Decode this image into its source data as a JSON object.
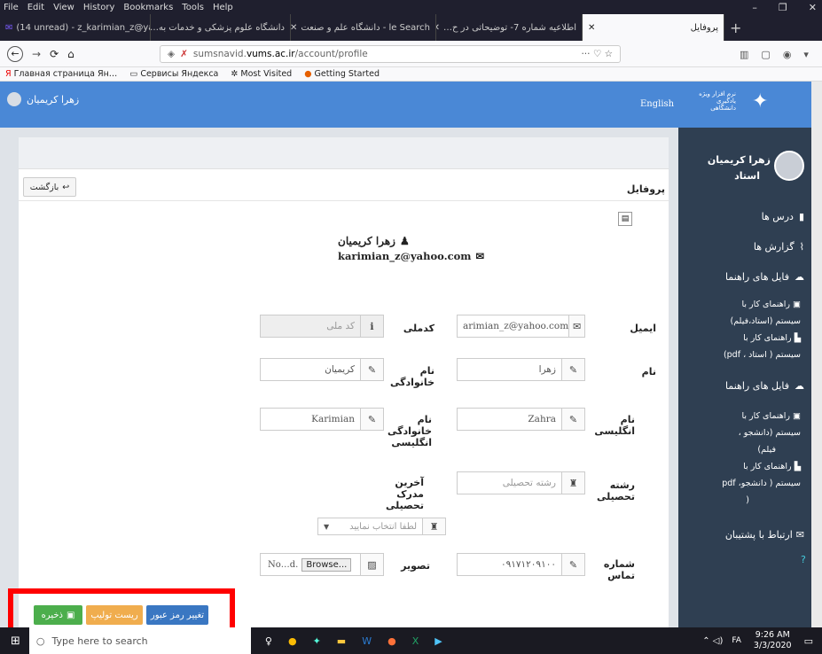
{
  "menu": [
    "File",
    "Edit",
    "View",
    "History",
    "Bookmarks",
    "Tools",
    "Help"
  ],
  "tabs": [
    {
      "label": "(14 unread) - z_karimian_z@ya…"
    },
    {
      "label": "دانشگاه علوم پزشکی و خدمات به…"
    },
    {
      "label": "le Search - دانشگاه علم و صنعت"
    },
    {
      "label": "اطلاعیه شماره 7- توضیحاتی در ح…"
    },
    {
      "label": "پروفایل"
    }
  ],
  "new_tab": "+",
  "url": {
    "prefix": "sumsnavid.",
    "domain": "vums.ac.ir",
    "path": "/account/profile"
  },
  "nav": {
    "more": "···"
  },
  "bookmarks": [
    "Главная страница Ян…",
    "Сервисы Яндекса",
    "Most Visited",
    "Getting Started"
  ],
  "header": {
    "user_name": "زهرا کریمیان",
    "lang": "English",
    "logo_line1": "نرم افزار ویژه",
    "logo_line2": "یادگیری دانشگاهی"
  },
  "sidebar": {
    "user_name": "زهرا کریمیان",
    "role": "استاد",
    "items": [
      "درس ها",
      "گزارش ها",
      "فایل های راهنما"
    ],
    "guide1": [
      "راهنمای کار با",
      "سیستم (استاد،فیلم)",
      "راهنمای کار با",
      "سیستم ( استاد ، pdf)"
    ],
    "guide_title2": "فایل های راهنما",
    "guide2": [
      "راهنمای کار با",
      "سیستم (دانشجو ،",
      "فیلم)",
      "راهنمای کار با",
      "سیستم ( دانشجو، pdf",
      "("
    ],
    "support": "ارتباط با پشتیبان"
  },
  "page": {
    "title": "پروفایل",
    "back": "بازگشت",
    "profile_name": "زهرا کریمیان",
    "profile_email": "karimian_z@yahoo.com"
  },
  "form": {
    "email_label": "ایمیل",
    "email_value": "arimian_z@yahoo.com",
    "national_label": "کدملی",
    "national_placeholder": "کد ملی",
    "first_label": "نام",
    "first_value": "زهرا",
    "last_label": "نام خانوادگی",
    "last_value": "کریمیان",
    "en_first_label": "نام انگلیسی",
    "en_first_value": "Zahra",
    "en_last_label": "نام خانوادگی انگلیسی",
    "en_last_value": "Karimian",
    "field_label": "رشته تحصیلی",
    "field_placeholder": "رشته تحصیلی",
    "degree_label": "آخرین مدرک تحصیلی",
    "degree_select": "لطفا انتخاب نمایید",
    "phone_label": "شماره تماس",
    "phone_value": "۰۹۱۷۱۲۰۹۱۰۰",
    "image_label": "تصویر",
    "image_browse": "Browse...",
    "image_file": "No…d."
  },
  "buttons": {
    "save": "ذخیره",
    "reset": "ریست تولیپ",
    "change_pass": "تغییر رمز عبور"
  },
  "taskbar": {
    "search": "Type here to search",
    "time": "9:26 AM",
    "date": "3/3/2020",
    "lang": "FA"
  },
  "colors": {
    "header": "#4a88d6",
    "sidebar": "#2f3f52",
    "save": "#4cae4c",
    "reset": "#f0ad4e",
    "change_pass": "#3a77c2",
    "highlight": "#ff0000"
  }
}
